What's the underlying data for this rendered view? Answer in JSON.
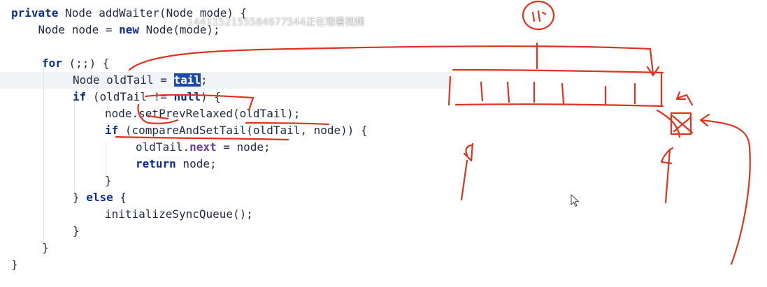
{
  "code": {
    "lines": [
      {
        "kw1": "private",
        "rest": " Node addWaiter(Node mode) {"
      },
      {
        "pre": "    Node node = ",
        "kw": "new",
        "post": " Node(mode);"
      },
      {
        "text": ""
      },
      {
        "kw": "for",
        "post": " (;;) {"
      },
      {
        "pre": "Node oldTail = ",
        "sel": "tail",
        "post": ";"
      },
      {
        "kw": "if",
        "post": " (oldTail != ",
        "kw2": "null",
        "post2": ") {"
      },
      {
        "text": "node.setPrevRelaxed(oldTail);"
      },
      {
        "kw": "if",
        "post": " (compareAndSetTail(oldTail, node)) {"
      },
      {
        "pre": "oldTail.",
        "field": "next",
        "post": " = node;"
      },
      {
        "kw": "return",
        "post": " node;"
      },
      {
        "text": "}"
      },
      {
        "pre": "} ",
        "kw": "else",
        "post": " {"
      },
      {
        "text": "initializeSyncQueue();"
      },
      {
        "text": "}"
      },
      {
        "text": "}"
      },
      {
        "text": "}"
      }
    ]
  },
  "watermark": "1441152155584677544正在观看视频",
  "annotation_color": "#e0321e",
  "highlight_line_color": "#f2f3f7",
  "selection_color": "#1d4aa7"
}
